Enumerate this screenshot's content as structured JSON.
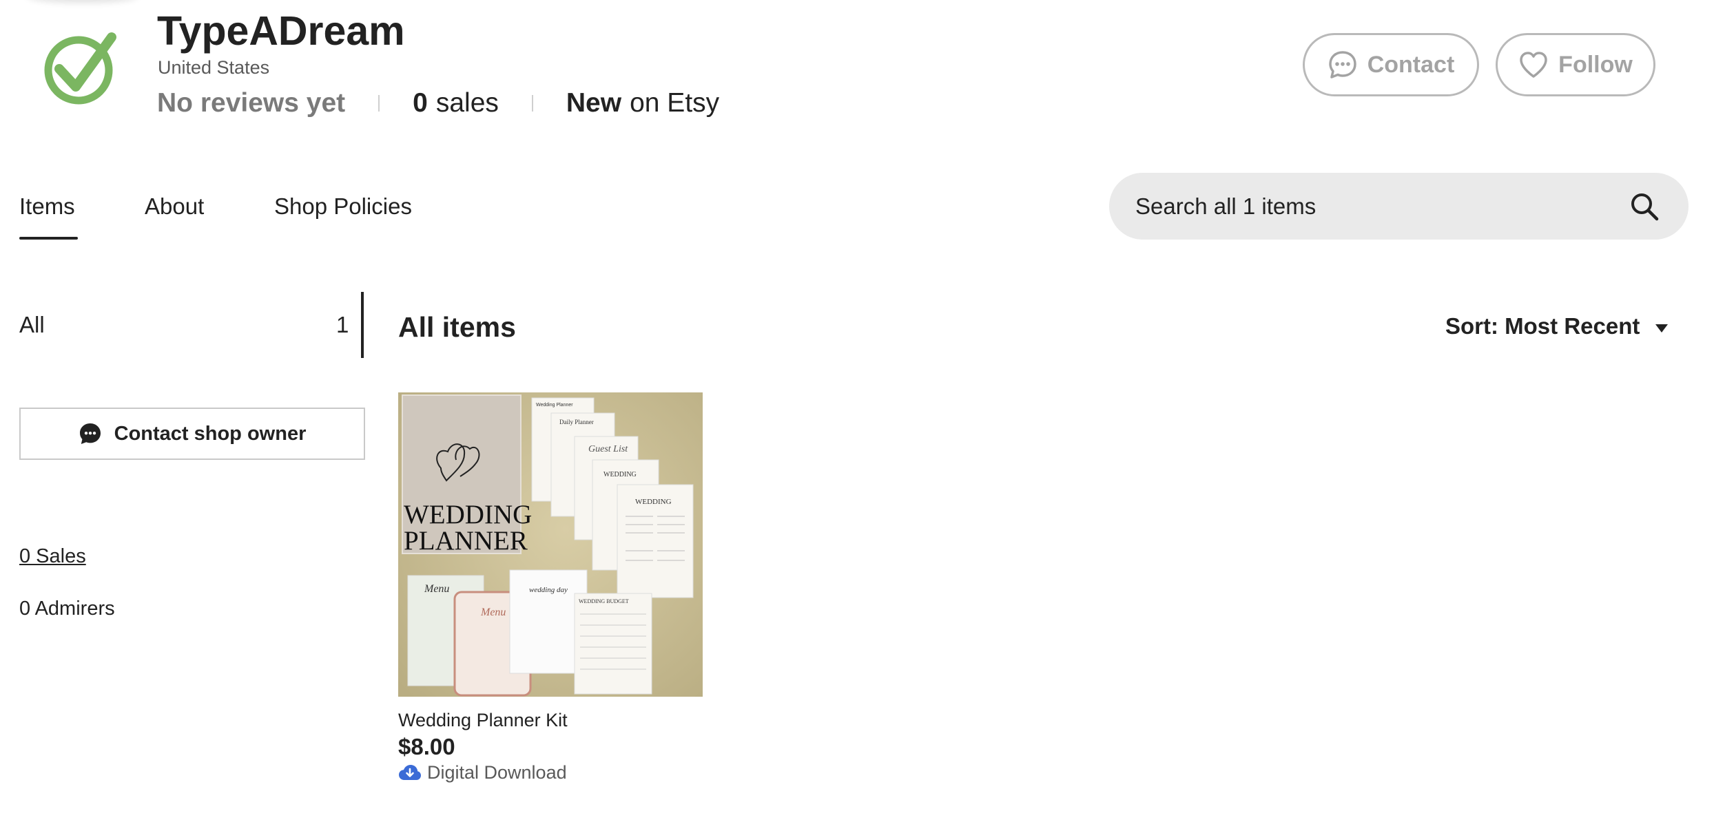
{
  "shop": {
    "name": "TypeADream",
    "location": "United States",
    "reviews": "No reviews yet",
    "sales_count": "0",
    "sales_label": "sales",
    "new_label": "New",
    "on_etsy": "on Etsy",
    "logo_icon": "checkmark-circle-icon",
    "logo_color": "#7bb661"
  },
  "header_actions": {
    "contact_label": "Contact",
    "follow_label": "Follow",
    "contact_icon": "chat-bubble-icon",
    "follow_icon": "heart-icon"
  },
  "tabs": [
    {
      "label": "Items",
      "active": true
    },
    {
      "label": "About",
      "active": false
    },
    {
      "label": "Shop Policies",
      "active": false
    }
  ],
  "search": {
    "placeholder": "Search all 1 items",
    "icon": "search-icon"
  },
  "sidebar": {
    "categories": [
      {
        "label": "All",
        "count": "1",
        "selected": true
      }
    ],
    "contact_owner_label": "Contact shop owner",
    "sales_link": "0 Sales",
    "admirers": "0 Admirers"
  },
  "main": {
    "title": "All items",
    "sort_label": "Sort: Most Recent"
  },
  "listings": [
    {
      "title": "Wedding Planner Kit",
      "price": "$8.00",
      "download_label": "Digital Download",
      "image_cover_text_1": "WEDDING",
      "image_cover_text_2": "PLANNER",
      "image_page_labels": [
        "Wedding Planner",
        "Daily Planner",
        "Guest List",
        "WEDDING",
        "WEDDING",
        "Menu",
        "Menu",
        "wedding day",
        "WEDDING BUDGET"
      ]
    }
  ],
  "colors": {
    "text": "#222222",
    "muted": "#595959",
    "border": "#b9b9b9",
    "search_bg": "#eaeaea",
    "download_icon": "#3b6bd6"
  }
}
